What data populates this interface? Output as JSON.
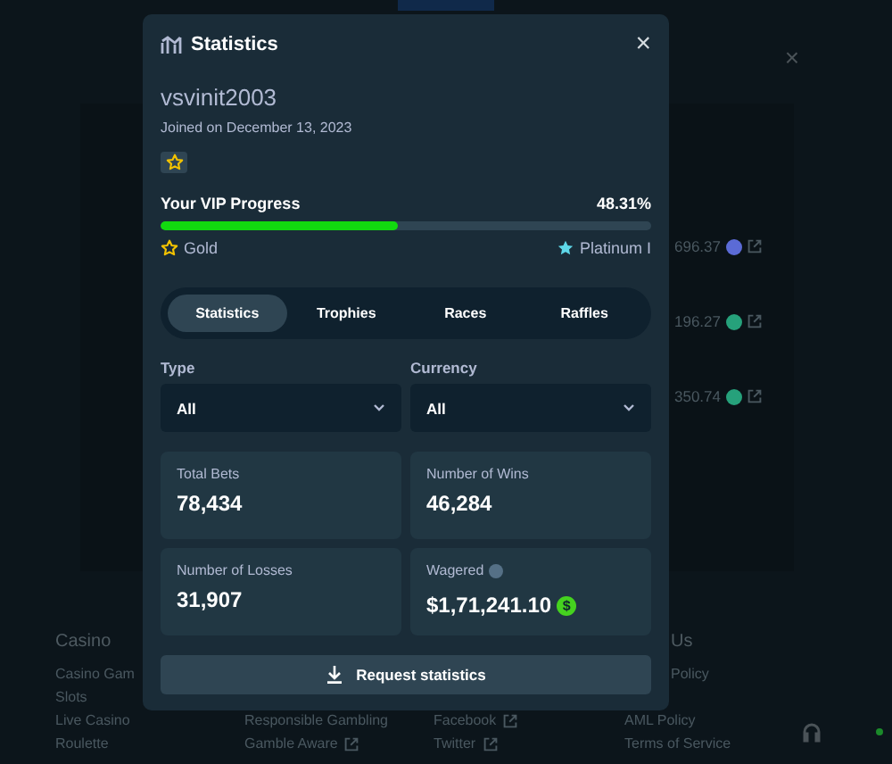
{
  "background": {
    "amounts": [
      {
        "value": "696.37",
        "color": "#5b6bd6"
      },
      {
        "value": "196.27",
        "color": "#26a17b"
      },
      {
        "value": "350.74",
        "color": "#26a17b"
      }
    ],
    "footer": [
      {
        "heading": "Casino",
        "links": [
          {
            "text": "Casino Gam"
          },
          {
            "text": "Slots"
          },
          {
            "text": "Live Casino"
          },
          {
            "text": "Roulette"
          }
        ]
      },
      {
        "links": [
          {
            "text": "Responsible Gambling"
          },
          {
            "text": "Gamble Aware",
            "external": true
          }
        ]
      },
      {
        "links": [
          {
            "text": "Facebook",
            "external": true
          },
          {
            "text": "Twitter",
            "external": true
          }
        ]
      },
      {
        "heading": "Us",
        "links": [
          {
            "text": "Policy"
          },
          {
            "text": "AML Policy"
          },
          {
            "text": "Terms of Service"
          }
        ]
      }
    ]
  },
  "modal": {
    "title": "Statistics",
    "close": "×",
    "username": "vsvinit2003",
    "joined": "Joined on December 13, 2023",
    "vip": {
      "label": "Your VIP Progress",
      "percent": "48.31%",
      "level": 0.4831,
      "current": "Gold",
      "next": "Platinum I"
    },
    "tabs": [
      {
        "label": "Statistics",
        "selected": true
      },
      {
        "label": "Trophies",
        "selected": false
      },
      {
        "label": "Races",
        "selected": false
      },
      {
        "label": "Raffles",
        "selected": false
      }
    ],
    "filters": [
      {
        "label": "Type",
        "value": "All"
      },
      {
        "label": "Currency",
        "value": "All"
      }
    ],
    "stats": [
      {
        "label": "Total Bets",
        "value": "78,434",
        "kind": "plain"
      },
      {
        "label": "Number of Wins",
        "value": "46,284",
        "kind": "plain"
      },
      {
        "label": "Number of Losses",
        "value": "31,907",
        "kind": "plain"
      },
      {
        "label": "Wagered",
        "value": "$1,71,241.10",
        "kind": "currency",
        "currency_symbol": "$"
      }
    ],
    "button": "Request statistics"
  }
}
